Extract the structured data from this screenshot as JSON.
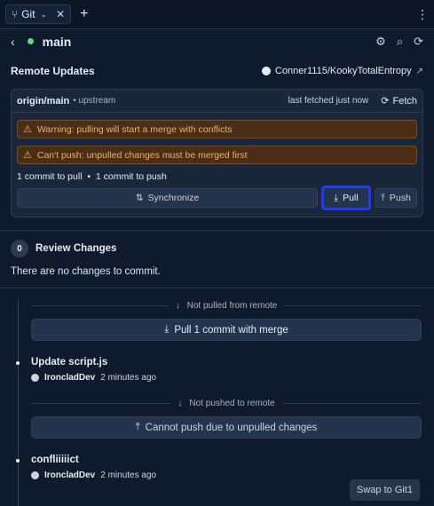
{
  "tab": {
    "label": "Git"
  },
  "header": {
    "branch": "main"
  },
  "remote": {
    "section_title": "Remote Updates",
    "repo": "Conner1115/KookyTotalEntropy",
    "origin": "origin/main",
    "upstream_label": "• upstream",
    "fetched": "last fetched just now",
    "fetch_label": "Fetch",
    "warning_pull": "Warning: pulling will start a merge with conflicts",
    "warning_push": "Can't push: unpulled changes must be merged first",
    "commit_counts": "1 commit to pull  •  1 commit to push",
    "sync_label": "Synchronize",
    "pull_label": "Pull",
    "push_label": "Push"
  },
  "review": {
    "count": "0",
    "title": "Review Changes",
    "empty_text": "There are no changes to commit."
  },
  "timeline": {
    "marker_not_pulled": "Not pulled from remote",
    "pull_button": "Pull 1 commit with merge",
    "commits": [
      {
        "title": "Update script.js",
        "author": "IroncladDev",
        "ago": "2 minutes ago"
      },
      {
        "title": "confliiiiict",
        "author": "IroncladDev",
        "ago": "2 minutes ago"
      }
    ],
    "marker_not_pushed": "Not pushed to remote",
    "push_button": "Cannot push due to unpulled changes"
  },
  "swap_label": "Swap to Git1",
  "colors": {
    "accent_highlight": "#1e3cf0",
    "warning_bg": "#4a2e15",
    "warning_text": "#f0b066",
    "branch_dot": "#6ecf8a"
  }
}
